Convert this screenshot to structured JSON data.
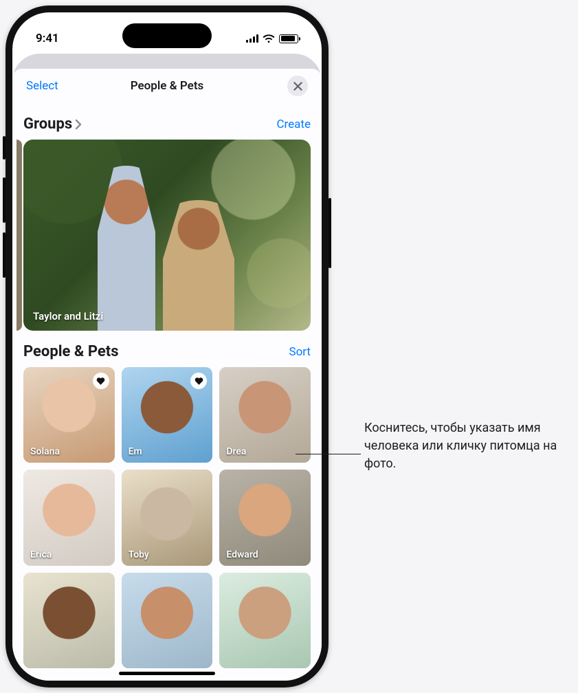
{
  "status_bar": {
    "time": "9:41"
  },
  "nav": {
    "select": "Select",
    "title": "People & Pets"
  },
  "groups": {
    "title": "Groups",
    "create": "Create",
    "card_label": "Taylor and Litzi"
  },
  "people": {
    "title": "People & Pets",
    "sort": "Sort",
    "items": [
      {
        "name": "Solana",
        "favorite": true,
        "bg": "bg-solana"
      },
      {
        "name": "Em",
        "favorite": true,
        "bg": "bg-em"
      },
      {
        "name": "Drea",
        "favorite": false,
        "bg": "bg-drea"
      },
      {
        "name": "Erica",
        "favorite": false,
        "bg": "bg-erica"
      },
      {
        "name": "Toby",
        "favorite": false,
        "bg": "bg-toby"
      },
      {
        "name": "Edward",
        "favorite": false,
        "bg": "bg-edward"
      },
      {
        "name": "",
        "favorite": false,
        "bg": "bg-p7"
      },
      {
        "name": "",
        "favorite": false,
        "bg": "bg-p8"
      },
      {
        "name": "",
        "favorite": false,
        "bg": "bg-p9"
      }
    ]
  },
  "callout": {
    "text": "Коснитесь, чтобы указать имя человека или кличку питомца на фото."
  }
}
